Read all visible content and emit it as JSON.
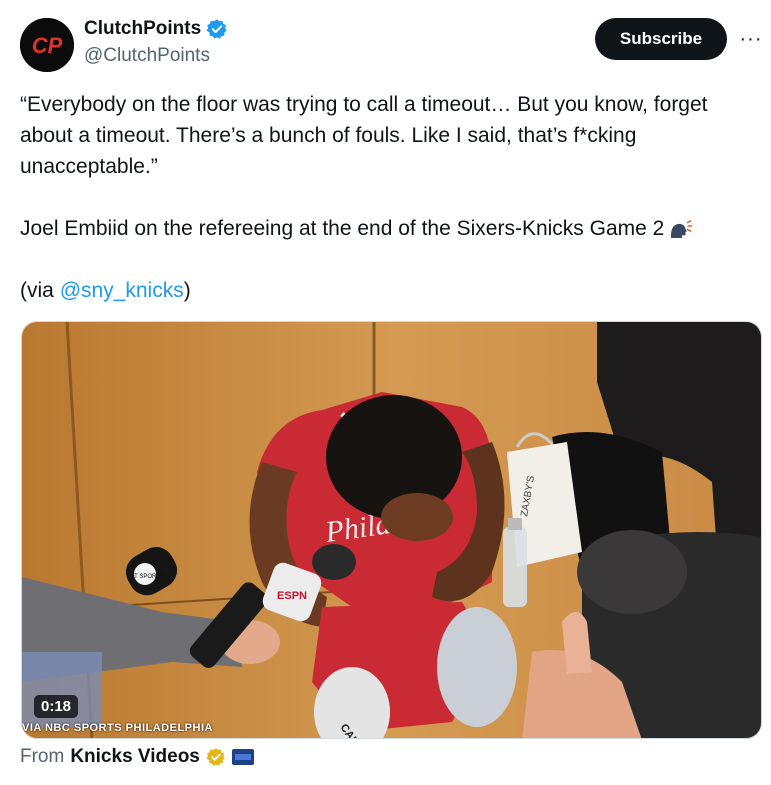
{
  "author": {
    "name": "ClutchPoints",
    "handle": "@ClutchPoints",
    "avatar_text": "CP",
    "verified_icon": "blue-verified-badge"
  },
  "actions": {
    "subscribe_label": "Subscribe",
    "more_label": "···"
  },
  "tweet": {
    "quote": "“Everybody on the floor was trying to call a timeout… But you know, forget about a timeout. There’s a bunch of fouls. Like I said, that’s f*cking unacceptable.”",
    "context": "Joel Embiid on the refereeing at the end of the Sixers-Knicks Game 2",
    "context_emoji": "speaking-head-emoji",
    "via_prefix": "(via ",
    "via_mention": "@sny_knicks",
    "via_suffix": ")"
  },
  "media": {
    "duration": "0:18",
    "credit": "VIA NBC SPORTS PHILADELPHIA",
    "jersey_text": "Phila",
    "mic_brand": "ESPN",
    "mic_brand_2": "TNT SPORTS",
    "mic_brand_3": "CANAL",
    "bag_text": "ZAXBY'S"
  },
  "source": {
    "prefix": "From",
    "name": "Knicks Videos",
    "badge": "gold-verified-badge",
    "affiliate_icon": "sny-affiliate-icon"
  },
  "colors": {
    "accent": "#1d9bf0",
    "text": "#0f1419",
    "muted": "#536471",
    "button": "#0f1419",
    "gold": "#e2b719"
  }
}
